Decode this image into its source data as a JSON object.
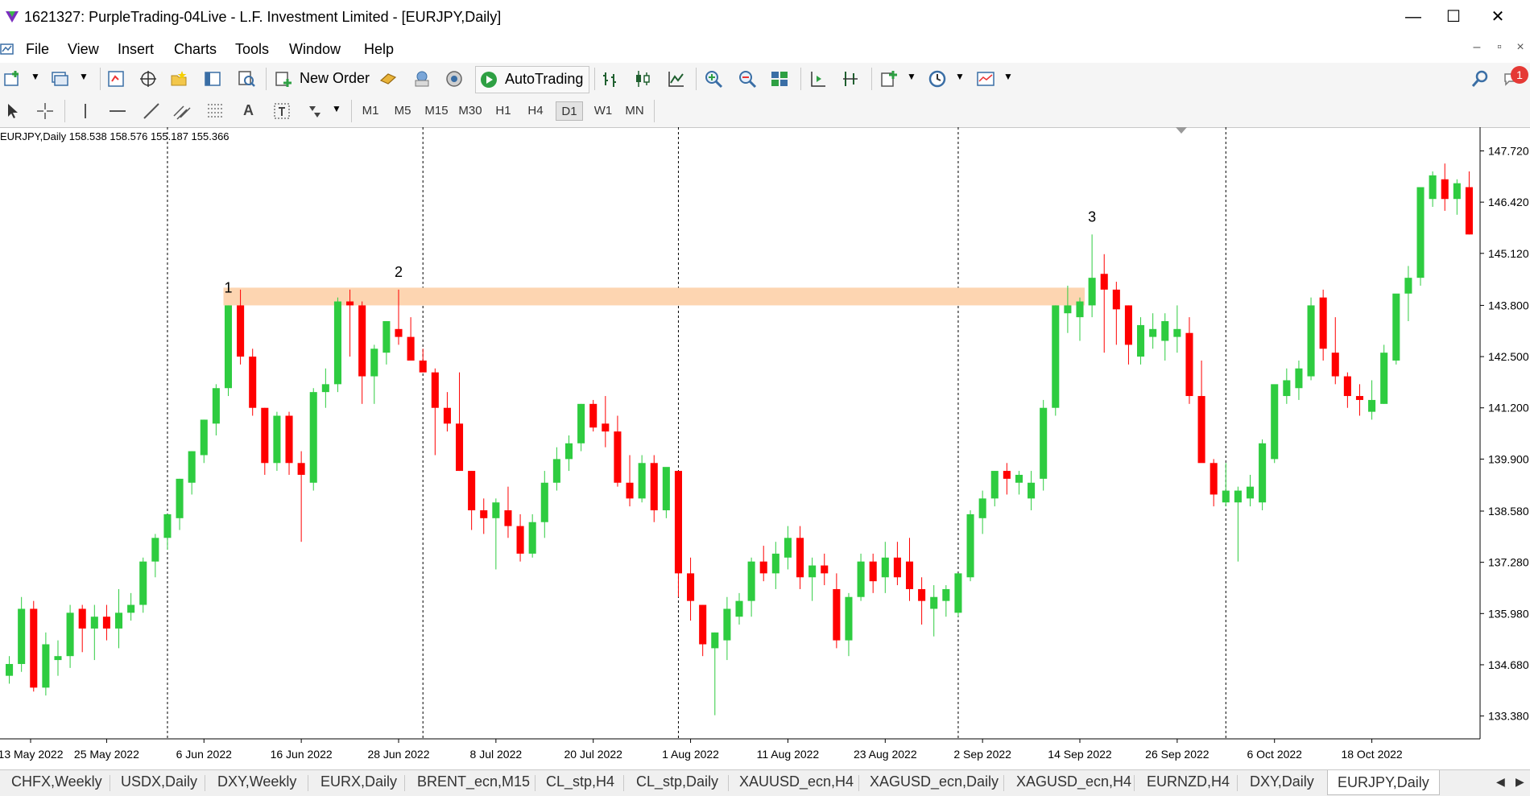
{
  "window": {
    "title": "1621327: PurpleTrading-04Live - L.F. Investment Limited - [EURJPY,Daily]",
    "minimize": "—",
    "maximize": "☐",
    "close": "✕"
  },
  "menu": [
    "File",
    "View",
    "Insert",
    "Charts",
    "Tools",
    "Window",
    "Help"
  ],
  "mdi": {
    "minimize": "–",
    "restore": "▫",
    "close": "×"
  },
  "toolbar": {
    "new_order": "New Order",
    "autotrading": "AutoTrading",
    "notification_count": "1"
  },
  "timeframes": [
    "M1",
    "M5",
    "M15",
    "M30",
    "H1",
    "H4",
    "D1",
    "W1",
    "MN"
  ],
  "active_timeframe": "D1",
  "chart": {
    "header": "EURJPY,Daily  158.538 158.576 155.187 155.366",
    "labels": [
      "1",
      "2",
      "3"
    ],
    "zone_color": "#fdd5b1"
  },
  "chart_data": {
    "type": "candlestick",
    "symbol": "EURJPY",
    "timeframe": "Daily",
    "ylim": [
      132.8,
      148.2
    ],
    "y_ticks": [
      "147.720",
      "146.420",
      "145.120",
      "143.800",
      "142.500",
      "141.200",
      "139.900",
      "138.580",
      "137.280",
      "135.980",
      "134.680",
      "133.380"
    ],
    "x_ticks": [
      "13 May 2022",
      "25 May 2022",
      "6 Jun 2022",
      "16 Jun 2022",
      "28 Jun 2022",
      "8 Jul 2022",
      "20 Jul 2022",
      "1 Aug 2022",
      "11 Aug 2022",
      "23 Aug 2022",
      "2 Sep 2022",
      "14 Sep 2022",
      "26 Sep 2022",
      "6 Oct 2022",
      "18 Oct 2022"
    ],
    "resistance_zone": [
      143.8,
      144.25
    ],
    "candles": [
      [
        134.4,
        134.9,
        134.2,
        134.7
      ],
      [
        134.7,
        136.4,
        134.5,
        136.1
      ],
      [
        136.1,
        136.3,
        134.0,
        134.1
      ],
      [
        134.1,
        135.5,
        133.9,
        135.2
      ],
      [
        134.8,
        135.3,
        134.4,
        134.9
      ],
      [
        134.9,
        136.2,
        134.6,
        136.0
      ],
      [
        136.1,
        136.2,
        135.0,
        135.6
      ],
      [
        135.6,
        136.2,
        134.8,
        135.9
      ],
      [
        135.9,
        136.2,
        135.3,
        135.6
      ],
      [
        135.6,
        136.6,
        135.1,
        136.0
      ],
      [
        136.0,
        136.5,
        135.8,
        136.2
      ],
      [
        136.2,
        137.4,
        136.0,
        137.3
      ],
      [
        137.3,
        138.0,
        136.9,
        137.9
      ],
      [
        137.9,
        138.5,
        137.6,
        138.5
      ],
      [
        138.4,
        139.4,
        138.1,
        139.4
      ],
      [
        139.3,
        140.1,
        139.0,
        140.1
      ],
      [
        140.0,
        140.9,
        139.8,
        140.9
      ],
      [
        140.8,
        141.8,
        140.5,
        141.7
      ],
      [
        141.7,
        143.8,
        141.5,
        143.8
      ],
      [
        143.8,
        144.2,
        142.3,
        142.5
      ],
      [
        142.5,
        142.7,
        141.0,
        141.2
      ],
      [
        141.2,
        141.2,
        139.5,
        139.8
      ],
      [
        139.8,
        141.1,
        139.6,
        141.0
      ],
      [
        141.0,
        141.1,
        139.5,
        139.8
      ],
      [
        139.8,
        140.1,
        137.8,
        139.5
      ],
      [
        139.3,
        141.7,
        139.1,
        141.6
      ],
      [
        141.6,
        142.2,
        141.2,
        141.8
      ],
      [
        141.8,
        144.0,
        141.6,
        143.9
      ],
      [
        143.9,
        144.2,
        142.5,
        143.8
      ],
      [
        143.8,
        143.9,
        141.3,
        142.0
      ],
      [
        142.0,
        142.8,
        141.3,
        142.7
      ],
      [
        142.6,
        143.4,
        142.3,
        143.4
      ],
      [
        143.2,
        144.2,
        142.8,
        143.0
      ],
      [
        143.0,
        143.5,
        142.5,
        142.4
      ],
      [
        142.4,
        142.7,
        142.1,
        142.1
      ],
      [
        142.1,
        142.2,
        140.0,
        141.2
      ],
      [
        141.2,
        141.6,
        140.6,
        140.8
      ],
      [
        140.8,
        142.1,
        139.6,
        139.6
      ],
      [
        139.6,
        139.6,
        138.1,
        138.6
      ],
      [
        138.6,
        138.9,
        138.0,
        138.4
      ],
      [
        138.4,
        138.9,
        137.1,
        138.8
      ],
      [
        138.6,
        139.2,
        137.9,
        138.2
      ],
      [
        138.2,
        138.5,
        137.3,
        137.5
      ],
      [
        137.5,
        138.5,
        137.4,
        138.3
      ],
      [
        138.3,
        139.6,
        137.9,
        139.3
      ],
      [
        139.3,
        140.2,
        139.1,
        139.9
      ],
      [
        139.9,
        140.5,
        139.6,
        140.3
      ],
      [
        140.3,
        141.3,
        140.1,
        141.3
      ],
      [
        141.3,
        141.4,
        140.6,
        140.7
      ],
      [
        140.8,
        141.5,
        140.2,
        140.6
      ],
      [
        140.6,
        141.0,
        139.2,
        139.3
      ],
      [
        139.3,
        140.0,
        138.7,
        138.9
      ],
      [
        138.9,
        140.0,
        138.8,
        139.8
      ],
      [
        139.8,
        140.0,
        138.3,
        138.6
      ],
      [
        138.6,
        139.6,
        138.4,
        139.7
      ],
      [
        139.6,
        139.6,
        136.4,
        137.0
      ],
      [
        137.0,
        137.4,
        135.8,
        136.3
      ],
      [
        136.2,
        136.2,
        134.9,
        135.2
      ],
      [
        135.1,
        135.5,
        133.4,
        135.5
      ],
      [
        135.3,
        136.4,
        134.8,
        136.1
      ],
      [
        135.9,
        136.5,
        135.7,
        136.3
      ],
      [
        136.3,
        137.4,
        135.9,
        137.3
      ],
      [
        137.3,
        137.7,
        136.8,
        137.0
      ],
      [
        137.0,
        137.8,
        136.6,
        137.5
      ],
      [
        137.4,
        138.2,
        137.1,
        137.9
      ],
      [
        137.9,
        138.2,
        136.6,
        136.9
      ],
      [
        136.9,
        137.4,
        136.3,
        137.2
      ],
      [
        137.2,
        137.5,
        136.7,
        137.0
      ],
      [
        136.6,
        137.0,
        135.1,
        135.3
      ],
      [
        135.3,
        136.5,
        134.9,
        136.4
      ],
      [
        136.4,
        137.5,
        136.3,
        137.3
      ],
      [
        137.3,
        137.5,
        136.5,
        136.8
      ],
      [
        136.9,
        137.8,
        136.5,
        137.4
      ],
      [
        137.4,
        137.8,
        136.7,
        136.9
      ],
      [
        137.3,
        137.9,
        136.3,
        136.6
      ],
      [
        136.6,
        136.9,
        135.7,
        136.3
      ],
      [
        136.1,
        136.7,
        135.4,
        136.4
      ],
      [
        136.3,
        136.7,
        135.9,
        136.6
      ],
      [
        136.0,
        137.0,
        135.9,
        137.0
      ],
      [
        136.9,
        138.6,
        136.8,
        138.5
      ],
      [
        138.4,
        139.1,
        138.0,
        138.9
      ],
      [
        138.9,
        139.6,
        138.7,
        139.6
      ],
      [
        139.6,
        139.8,
        139.0,
        139.4
      ],
      [
        139.3,
        139.6,
        139.0,
        139.5
      ],
      [
        138.9,
        139.6,
        138.6,
        139.3
      ],
      [
        139.4,
        141.4,
        139.1,
        141.2
      ],
      [
        141.2,
        143.8,
        141.0,
        143.8
      ],
      [
        143.6,
        144.3,
        143.1,
        143.8
      ],
      [
        143.5,
        144.0,
        142.9,
        143.9
      ],
      [
        143.8,
        145.6,
        143.5,
        144.5
      ],
      [
        144.6,
        145.1,
        142.6,
        144.2
      ],
      [
        144.2,
        144.4,
        142.8,
        143.7
      ],
      [
        143.8,
        143.8,
        142.3,
        142.8
      ],
      [
        142.5,
        143.5,
        142.3,
        143.3
      ],
      [
        143.0,
        143.6,
        142.7,
        143.2
      ],
      [
        142.9,
        143.6,
        142.4,
        143.4
      ],
      [
        143.0,
        143.8,
        142.6,
        143.2
      ],
      [
        143.1,
        143.5,
        141.3,
        141.5
      ],
      [
        141.5,
        142.4,
        139.9,
        139.8
      ],
      [
        139.8,
        139.9,
        138.7,
        139.0
      ],
      [
        138.8,
        139.8,
        138.7,
        139.1
      ],
      [
        138.8,
        139.2,
        137.3,
        139.1
      ],
      [
        138.9,
        139.5,
        138.7,
        139.2
      ],
      [
        138.8,
        140.4,
        138.6,
        140.3
      ],
      [
        139.9,
        141.6,
        139.8,
        141.8
      ],
      [
        141.5,
        142.2,
        141.3,
        141.9
      ],
      [
        141.7,
        142.4,
        141.4,
        142.2
      ],
      [
        142.0,
        144.0,
        141.9,
        143.8
      ],
      [
        144.0,
        144.2,
        142.4,
        142.7
      ],
      [
        142.6,
        143.5,
        141.8,
        142.0
      ],
      [
        142.0,
        142.1,
        141.2,
        141.5
      ],
      [
        141.5,
        141.8,
        141.0,
        141.4
      ],
      [
        141.1,
        141.9,
        140.9,
        141.4
      ],
      [
        141.3,
        142.8,
        141.3,
        142.6
      ],
      [
        142.4,
        143.9,
        142.3,
        144.1
      ],
      [
        144.1,
        144.8,
        143.4,
        144.5
      ],
      [
        144.5,
        146.5,
        144.3,
        146.8
      ],
      [
        146.5,
        147.2,
        146.3,
        147.1
      ],
      [
        147.0,
        147.4,
        146.2,
        146.5
      ],
      [
        146.5,
        147.0,
        146.1,
        146.9
      ],
      [
        146.8,
        147.2,
        145.6,
        145.6
      ]
    ]
  },
  "tabs": [
    "CHFX,Weekly",
    "USDX,Daily",
    "DXY,Weekly",
    "EURX,Daily",
    "BRENT_ecn,M15",
    "CL_stp,H4",
    "CL_stp,Daily",
    "XAUUSD_ecn,H4",
    "XAGUSD_ecn,Daily",
    "XAGUSD_ecn,H4",
    "EURNZD,H4",
    "DXY,Daily",
    "EURJPY,Daily"
  ],
  "active_tab": "EURJPY,Daily",
  "colors": {
    "bull": "#2ecc40",
    "bear": "#ff0000",
    "grid": "#000000",
    "zone": "#fdd5b1"
  }
}
